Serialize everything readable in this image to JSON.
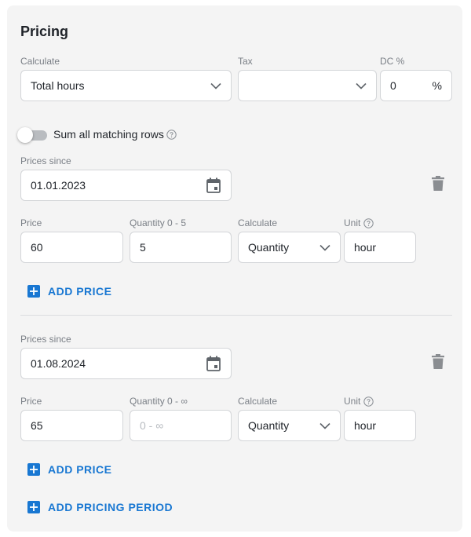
{
  "pricing": {
    "title": "Pricing",
    "calculate_label": "Calculate",
    "calculate_value": "Total hours",
    "tax_label": "Tax",
    "tax_value": "",
    "dc_label": "DC %",
    "dc_value": "0",
    "dc_suffix": "%",
    "sum_toggle": {
      "label": "Sum all matching rows",
      "enabled": false
    }
  },
  "periods": [
    {
      "prices_since_label": "Prices since",
      "date": "01.01.2023",
      "price_label": "Price",
      "price_value": "60",
      "quantity_label": "Quantity 0 - 5",
      "quantity_value": "5",
      "quantity_placeholder": "",
      "calc_label": "Calculate",
      "calc_value": "Quantity",
      "unit_label": "Unit",
      "unit_value": "hour",
      "add_price_label": "ADD PRICE"
    },
    {
      "prices_since_label": "Prices since",
      "date": "01.08.2024",
      "price_label": "Price",
      "price_value": "65",
      "quantity_label": "Quantity 0 - ∞",
      "quantity_value": "",
      "quantity_placeholder": "0 - ∞",
      "calc_label": "Calculate",
      "calc_value": "Quantity",
      "unit_label": "Unit",
      "unit_value": "hour",
      "add_price_label": "ADD PRICE"
    }
  ],
  "add_pricing_period_label": "ADD PRICING PERIOD",
  "colors": {
    "accent": "#1877d2",
    "panel_bg": "#f4f4f4",
    "border": "#d3d5d8",
    "label": "#7a7f86"
  },
  "icons": {
    "select": "chevron-down-icon",
    "date": "calendar-icon",
    "delete": "trash-icon",
    "help": "help-circle-icon",
    "add": "plus-square-icon"
  }
}
